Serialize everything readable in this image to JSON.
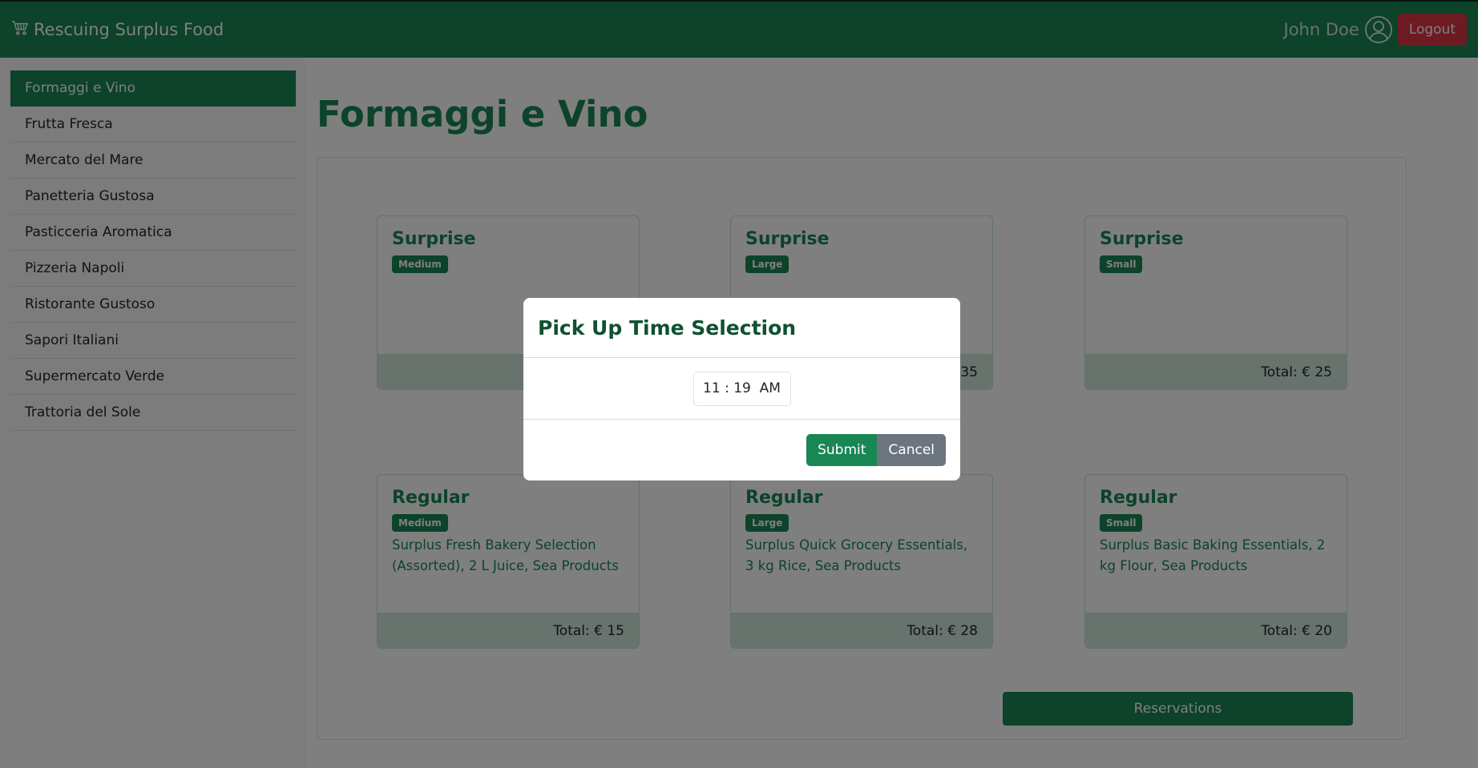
{
  "navbar": {
    "brand": "Rescuing Surplus Food",
    "brand_icon": "cart-icon",
    "user_name": "John Doe",
    "user_icon": "user-circle-icon",
    "logout_label": "Logout"
  },
  "sidebar": {
    "items": [
      {
        "label": "Formaggi e Vino",
        "active": true
      },
      {
        "label": "Frutta Fresca"
      },
      {
        "label": "Mercato del Mare"
      },
      {
        "label": "Panetteria Gustosa"
      },
      {
        "label": "Pasticceria Aromatica"
      },
      {
        "label": "Pizzeria Napoli"
      },
      {
        "label": "Ristorante Gustoso"
      },
      {
        "label": "Sapori Italiani"
      },
      {
        "label": "Supermercato Verde"
      },
      {
        "label": "Trattoria del Sole"
      }
    ]
  },
  "main": {
    "title": "Formaggi e Vino",
    "cards": [
      {
        "title": "Surprise",
        "size": "Medium",
        "desc": "",
        "total": ""
      },
      {
        "title": "Surprise",
        "size": "Large",
        "desc": "",
        "total": "35"
      },
      {
        "title": "Surprise",
        "size": "Small",
        "desc": "",
        "total": "Total: € 25"
      },
      {
        "title": "Regular",
        "size": "Medium",
        "desc": "Surplus Fresh Bakery Selection (Assorted), 2 L Juice, Sea Products",
        "total": "Total: € 15"
      },
      {
        "title": "Regular",
        "size": "Large",
        "desc": "Surplus Quick Grocery Essentials, 3 kg Rice, Sea Products",
        "total": "Total: € 28"
      },
      {
        "title": "Regular",
        "size": "Small",
        "desc": "Surplus Basic Baking Essentials, 2 kg Flour, Sea Products",
        "total": "Total: € 20"
      }
    ],
    "reservations_label": "Reservations"
  },
  "modal": {
    "title": "Pick Up Time Selection",
    "time_value": "11 : 19  AM",
    "submit_label": "Submit",
    "cancel_label": "Cancel"
  },
  "colors": {
    "primary": "#198754",
    "danger": "#dc3545",
    "secondary": "#6c757d",
    "footer_bg": "#d1e7dd"
  }
}
